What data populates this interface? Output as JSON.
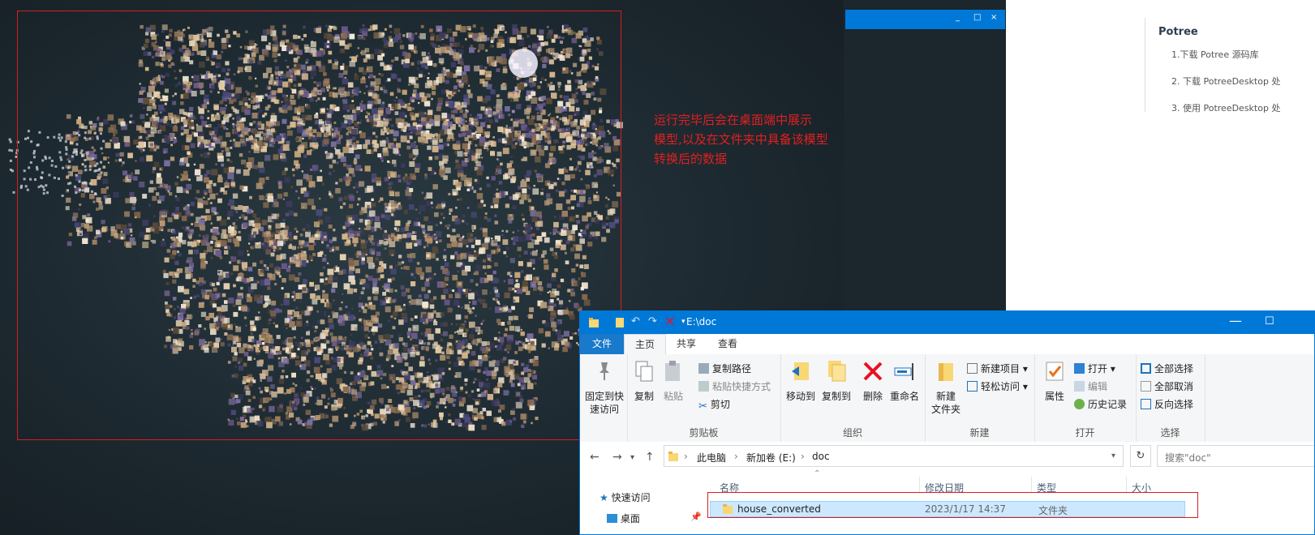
{
  "annotation": {
    "text_line1": "运行完毕后会在桌面端中展示",
    "text_line2": "模型,以及在文件夹中具备该模型",
    "text_line3": "转换后的数据",
    "color": "#e02020"
  },
  "mini_window": {
    "min": "_",
    "max": "□",
    "close": "×"
  },
  "doc_toc": {
    "heading": "Potree",
    "items": [
      "1.下载 Potree 源码库",
      "2. 下载 PotreeDesktop 处",
      "3. 使用 PotreeDesktop 处"
    ]
  },
  "explorer": {
    "title": "E:\\doc",
    "tabs": {
      "file": "文件",
      "home": "主页",
      "share": "共享",
      "view": "查看"
    },
    "ribbon": {
      "pin_line1": "固定到快",
      "pin_line2": "速访问",
      "copy": "复制",
      "paste": "粘贴",
      "copy_path": "复制路径",
      "paste_shortcut": "粘贴快捷方式",
      "cut": "剪切",
      "clipboard": "剪贴板",
      "move_to": "移动到",
      "copy_to": "复制到",
      "delete": "删除",
      "rename": "重命名",
      "organize": "组织",
      "new_folder_line1": "新建",
      "new_folder_line2": "文件夹",
      "new_item": "新建项目",
      "easy_access": "轻松访问",
      "new": "新建",
      "properties": "属性",
      "open": "打开",
      "edit": "编辑",
      "history": "历史记录",
      "open_group": "打开",
      "select_all": "全部选择",
      "select_none": "全部取消",
      "invert": "反向选择",
      "select": "选择"
    },
    "address": {
      "crumb1": "此电脑",
      "crumb2": "新加卷 (E:)",
      "crumb3": "doc",
      "search_placeholder": "搜索\"doc\""
    },
    "columns": {
      "name": "名称",
      "date": "修改日期",
      "type": "类型",
      "size": "大小"
    },
    "nav": {
      "quick_access": "快速访问",
      "desktop": "桌面"
    },
    "rows": [
      {
        "name": "house_converted",
        "date": "2023/1/17 14:37",
        "type": "文件夹"
      }
    ]
  }
}
